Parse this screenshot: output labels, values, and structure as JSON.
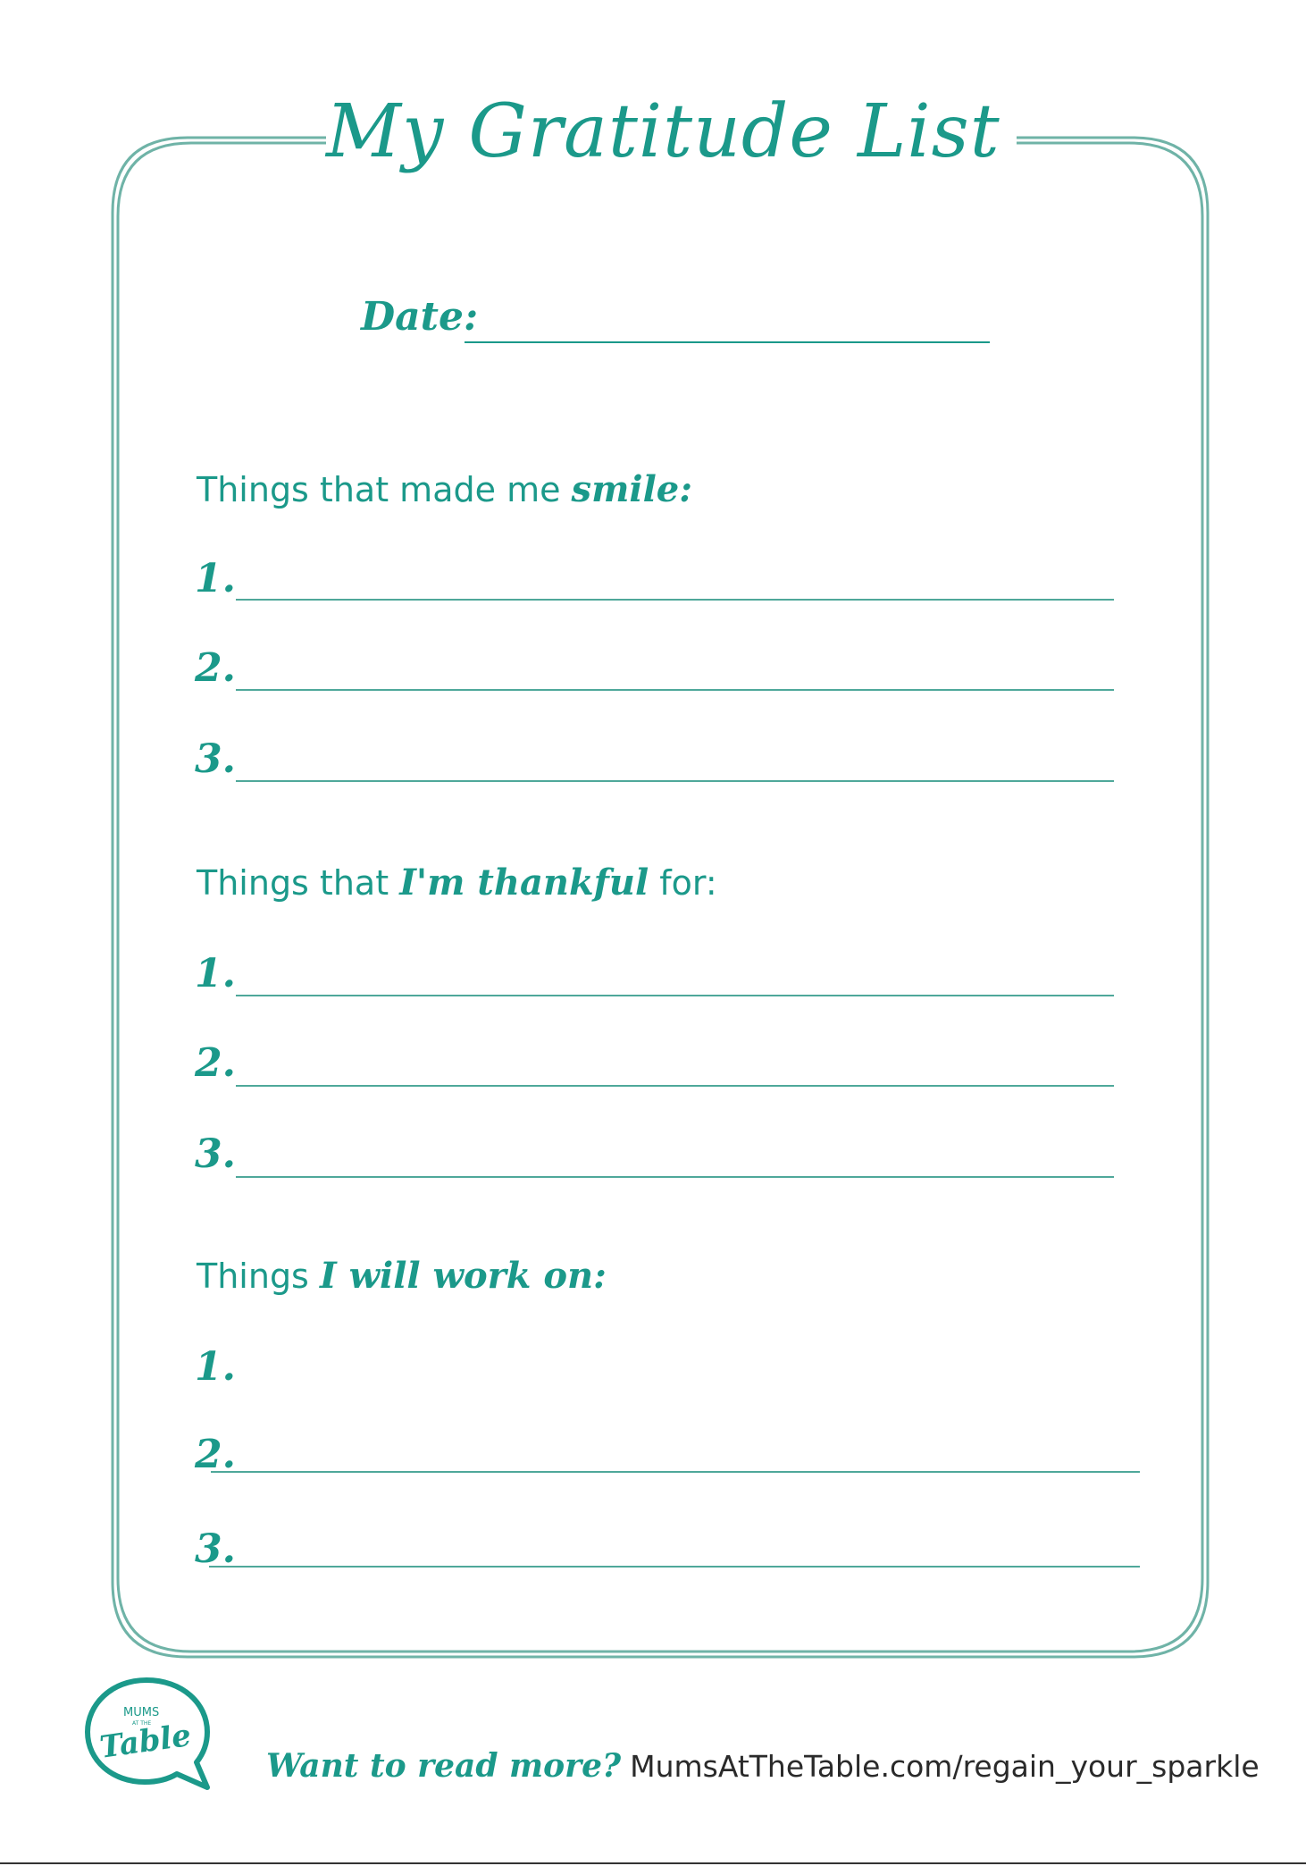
{
  "colors": {
    "accent": "#1b998a",
    "frame": "#6fb3a7",
    "url_text": "#2a2a2a"
  },
  "page": {
    "title": "My Gratitude List",
    "date_label": "Date:"
  },
  "sections": [
    {
      "prefix": "Things that made me ",
      "emphasis": "smile:",
      "suffix": "",
      "items": [
        "1.",
        "2.",
        "3."
      ]
    },
    {
      "prefix": "Things that ",
      "emphasis": "I'm thankful",
      "suffix": " for:",
      "items": [
        "1.",
        "2.",
        "3."
      ]
    },
    {
      "prefix": "Things ",
      "emphasis": "I will work on:",
      "suffix": "",
      "items": [
        "1.",
        "2.",
        "3."
      ]
    }
  ],
  "logo": {
    "top_text": "MUMS",
    "small_text": "AT THE",
    "main_text": "Table",
    "icon": "speech-bubble-icon"
  },
  "footer": {
    "prompt": "Want to read more?",
    "url": "MumsAtTheTable.com/regain_your_sparkle"
  }
}
